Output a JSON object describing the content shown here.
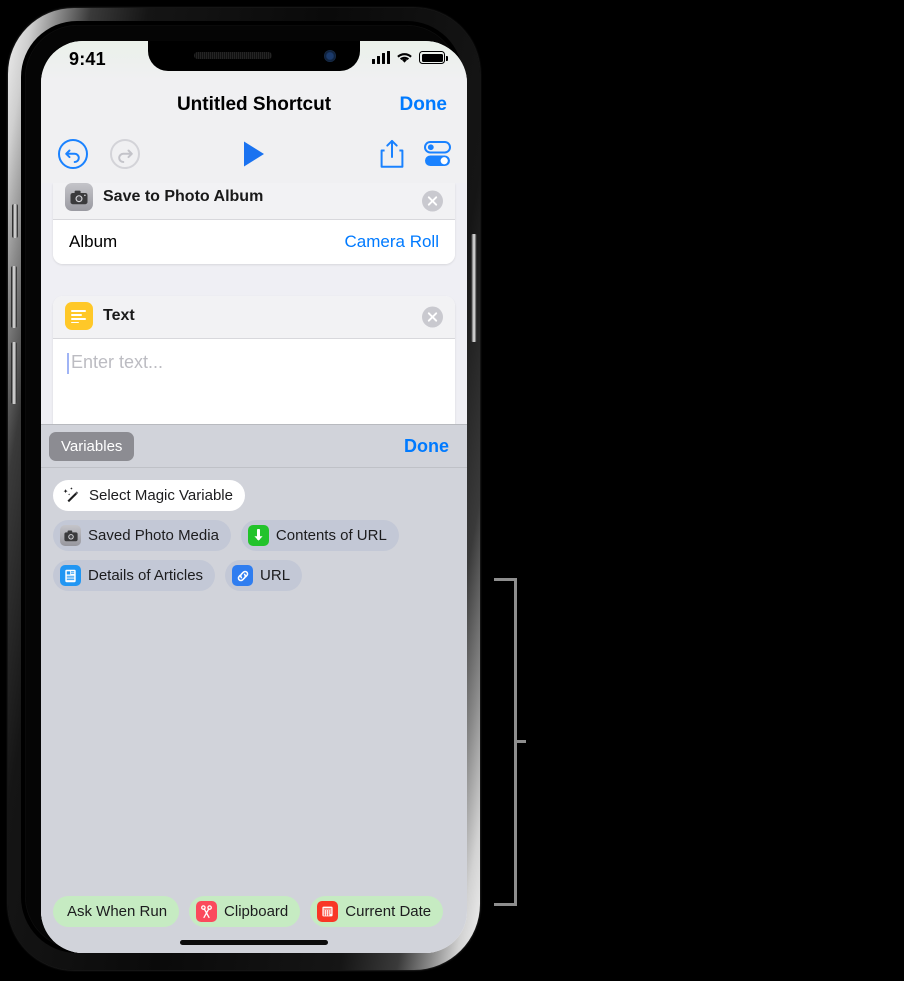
{
  "status_bar": {
    "time": "9:41",
    "cellular_icon": "signal-bars-icon",
    "wifi_icon": "wifi-icon",
    "battery_icon": "battery-full-icon"
  },
  "nav_bar": {
    "title": "Untitled Shortcut",
    "done_label": "Done"
  },
  "toolbar": {
    "undo_icon": "undo-icon",
    "redo_icon": "redo-icon",
    "play_icon": "play-icon",
    "share_icon": "share-icon",
    "settings_icon": "settings-toggles-icon"
  },
  "actions": [
    {
      "title": "Save to Photo Album",
      "icon": "camera-icon",
      "remove_icon": "close-circle-icon",
      "param_label": "Album",
      "param_value": "Camera Roll"
    },
    {
      "title": "Text",
      "icon": "text-lines-icon",
      "remove_icon": "close-circle-icon",
      "placeholder": "Enter text...",
      "value": ""
    }
  ],
  "variables_panel": {
    "tab_label": "Variables",
    "done_label": "Done",
    "magic_variable": {
      "label": "Select Magic Variable",
      "icon": "magic-wand-icon"
    },
    "magic_chips": [
      {
        "label": "Saved Photo Media",
        "icon": "camera-icon"
      },
      {
        "label": "Contents of URL",
        "icon": "download-arrow-icon"
      },
      {
        "label": "Details of Articles",
        "icon": "document-icon"
      },
      {
        "label": "URL",
        "icon": "link-icon"
      }
    ],
    "system_chips": [
      {
        "label": "Ask When Run",
        "icon": ""
      },
      {
        "label": "Clipboard",
        "icon": "scissors-icon"
      },
      {
        "label": "Current Date",
        "icon": "calendar-icon"
      }
    ]
  },
  "colors": {
    "accent_blue": "#007aff",
    "panel_gray": "#d1d3da",
    "chip_blue": "#c3c8d6",
    "chip_green": "#c6ebc2",
    "text_icon_yellow": "#ffc828"
  },
  "annotation": {
    "bracket": "callout-bracket"
  }
}
